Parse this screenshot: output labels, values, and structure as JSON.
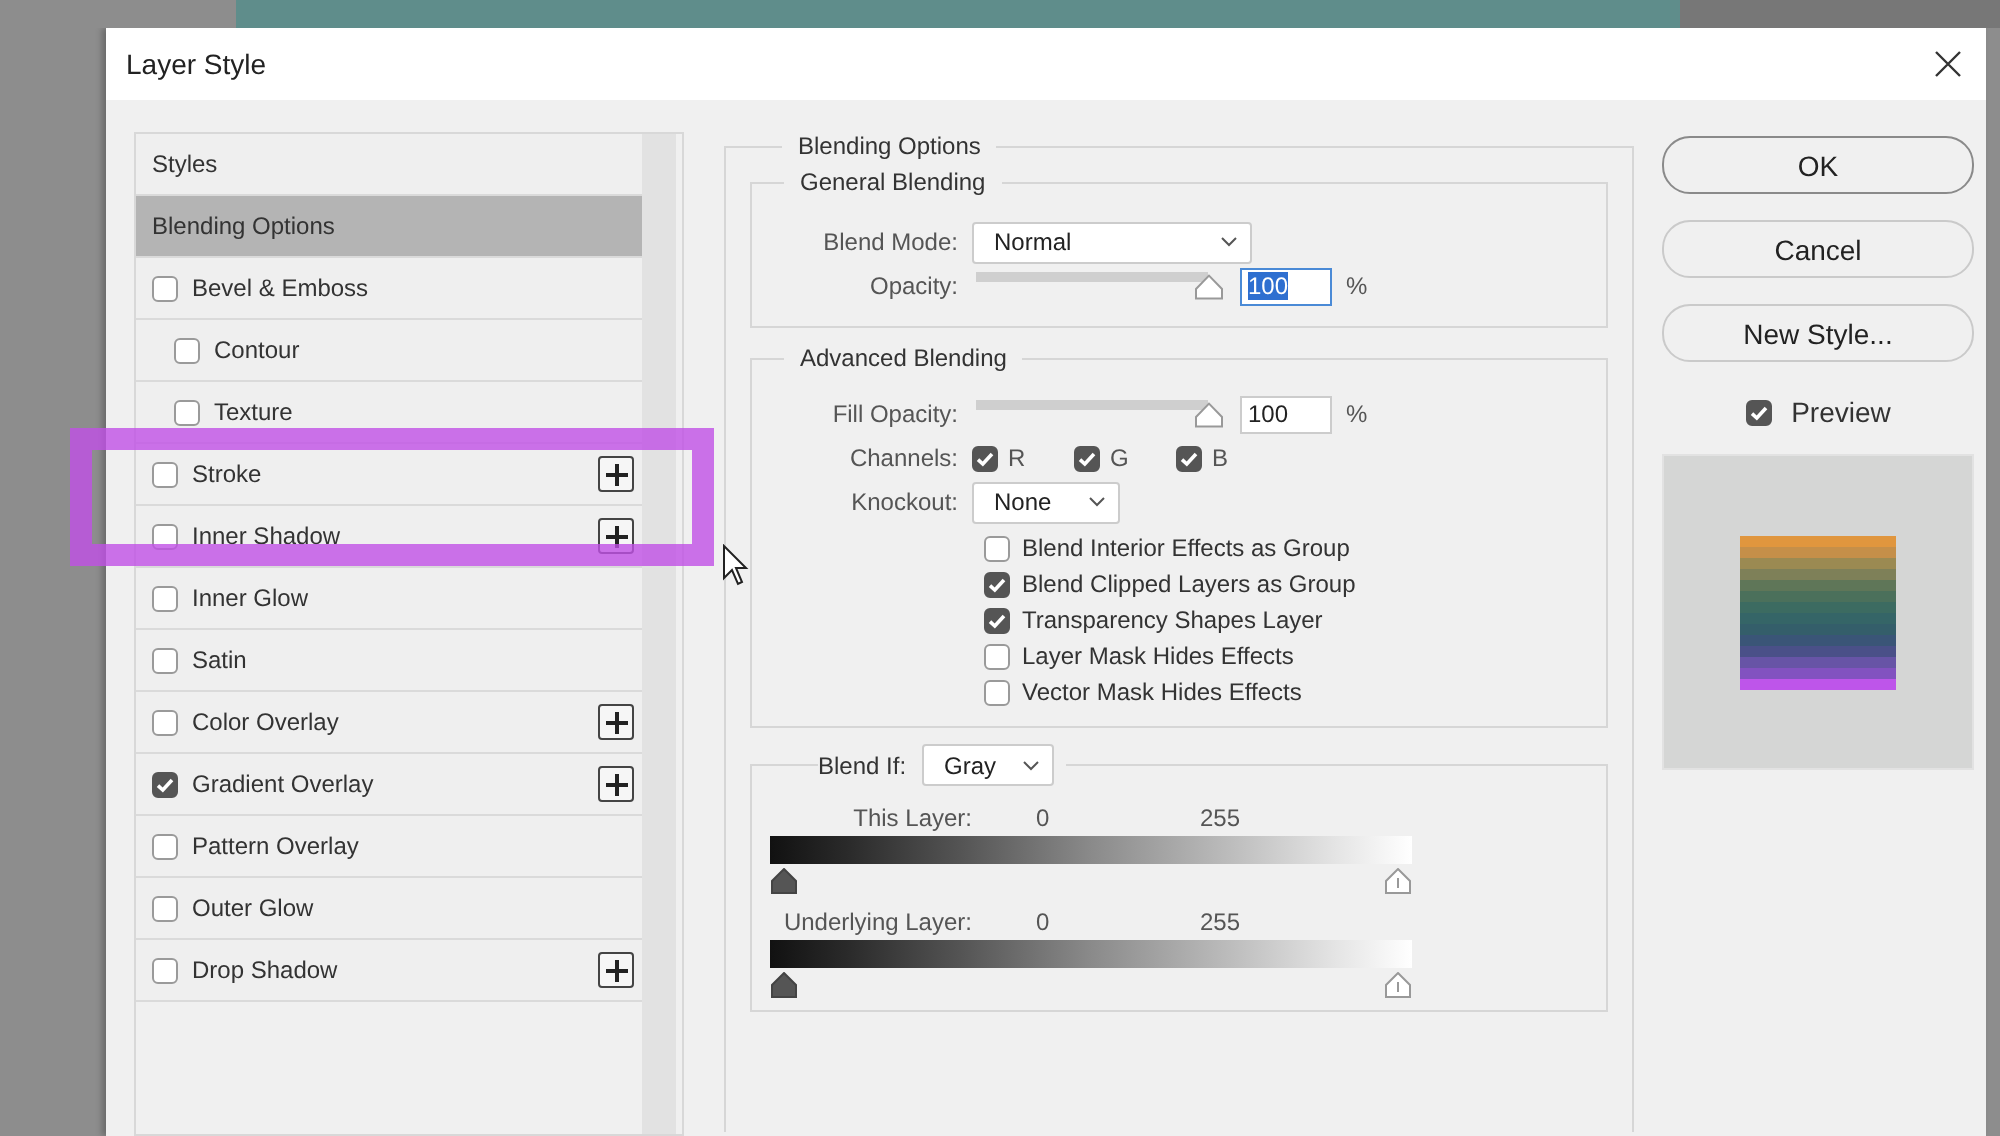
{
  "window": {
    "title": "Layer Style"
  },
  "styles_list": [
    {
      "label": "Styles",
      "kind": "header",
      "selected": false
    },
    {
      "label": "Blending Options",
      "kind": "header",
      "selected": true
    },
    {
      "label": "Bevel & Emboss",
      "kind": "option",
      "checked": false,
      "selected": false,
      "addable": false
    },
    {
      "label": "Contour",
      "kind": "sub",
      "checked": false,
      "selected": false,
      "addable": false
    },
    {
      "label": "Texture",
      "kind": "sub",
      "checked": false,
      "selected": false,
      "addable": false
    },
    {
      "label": "Stroke",
      "kind": "option",
      "checked": false,
      "selected": false,
      "addable": true
    },
    {
      "label": "Inner Shadow",
      "kind": "option",
      "checked": false,
      "selected": false,
      "addable": true
    },
    {
      "label": "Inner Glow",
      "kind": "option",
      "checked": false,
      "selected": false,
      "addable": false
    },
    {
      "label": "Satin",
      "kind": "option",
      "checked": false,
      "selected": false,
      "addable": false
    },
    {
      "label": "Color Overlay",
      "kind": "option",
      "checked": false,
      "selected": false,
      "addable": true
    },
    {
      "label": "Gradient Overlay",
      "kind": "option",
      "checked": true,
      "selected": false,
      "addable": true
    },
    {
      "label": "Pattern Overlay",
      "kind": "option",
      "checked": false,
      "selected": false,
      "addable": false
    },
    {
      "label": "Outer Glow",
      "kind": "option",
      "checked": false,
      "selected": false,
      "addable": false
    },
    {
      "label": "Drop Shadow",
      "kind": "option",
      "checked": false,
      "selected": false,
      "addable": true
    }
  ],
  "blending_options": {
    "title": "Blending Options",
    "general_blending": {
      "title": "General Blending",
      "blend_mode": {
        "label": "Blend Mode:",
        "value": "Normal"
      },
      "opacity": {
        "label": "Opacity:",
        "level": 1,
        "value": "100",
        "value_selected": true,
        "unit": "%"
      }
    },
    "advanced_blending": {
      "title": "Advanced Blending",
      "fill_opacity": {
        "label": "Fill Opacity:",
        "level": 1,
        "value": "100",
        "value_selected": false,
        "unit": "%"
      },
      "channels": {
        "label": "Channels:",
        "items": [
          {
            "label": "R",
            "checked": true
          },
          {
            "label": "G",
            "checked": true
          },
          {
            "label": "B",
            "checked": true
          }
        ]
      },
      "knockout": {
        "label": "Knockout:",
        "value": "None"
      },
      "options": [
        {
          "label": "Blend Interior Effects as Group",
          "checked": false
        },
        {
          "label": "Blend Clipped Layers as Group",
          "checked": true
        },
        {
          "label": "Transparency Shapes Layer",
          "checked": true
        },
        {
          "label": "Layer Mask Hides Effects",
          "checked": false
        },
        {
          "label": "Vector Mask Hides Effects",
          "checked": false
        }
      ]
    },
    "blend_if": {
      "label": "Blend If:",
      "value": "Gray",
      "layers": [
        {
          "label": "This Layer:",
          "min": "0",
          "max": "255"
        },
        {
          "label": "Underlying Layer:",
          "min": "0",
          "max": "255"
        }
      ]
    }
  },
  "buttons": [
    {
      "label": "OK",
      "default": true
    },
    {
      "label": "Cancel",
      "default": false
    },
    {
      "label": "New Style...",
      "default": false
    }
  ],
  "preview": {
    "label": "Preview",
    "checked": true
  }
}
